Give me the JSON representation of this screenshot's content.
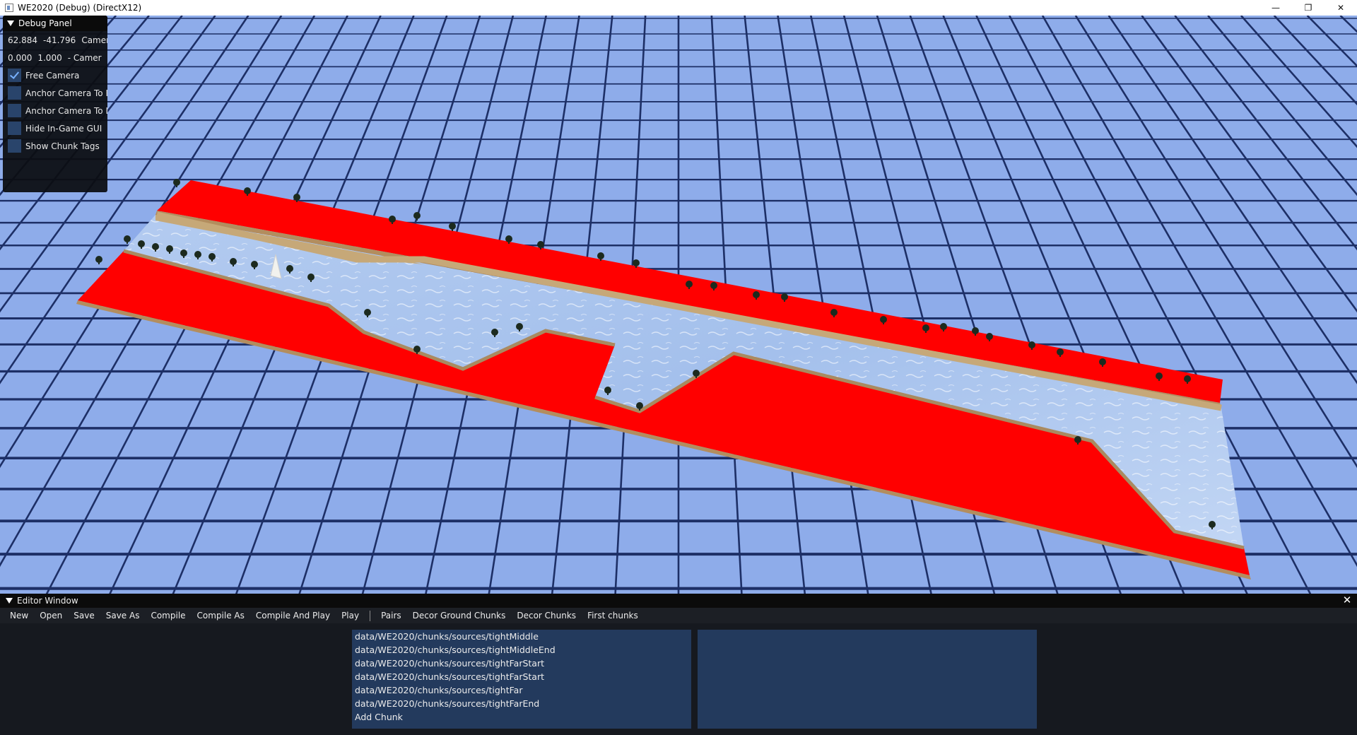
{
  "window": {
    "title": "WE2020 (Debug) (DirectX12)",
    "controls": [
      "—",
      "❐",
      "✕"
    ]
  },
  "debug_panel": {
    "title": "Debug Panel",
    "readouts": [
      {
        "values": [
          "62.884",
          "-41.796"
        ],
        "label": "Camer"
      },
      {
        "values": [
          "0.000",
          "1.000"
        ],
        "label": "- Camer"
      }
    ],
    "checkboxes": [
      {
        "label": "Free Camera",
        "checked": true
      },
      {
        "label": "Anchor Camera To I",
        "checked": false
      },
      {
        "label": "Anchor Camera To I",
        "checked": false
      },
      {
        "label": "Hide In-Game GUI",
        "checked": false
      },
      {
        "label": "Show Chunk Tags",
        "checked": false
      }
    ]
  },
  "editor": {
    "title": "Editor Window",
    "close": "✕",
    "menu": [
      "New",
      "Open",
      "Save",
      "Save As",
      "Compile",
      "Compile As",
      "Compile And Play",
      "Play"
    ],
    "menu2": [
      "Pairs",
      "Decor Ground Chunks",
      "Decor Chunks",
      "First chunks"
    ],
    "chunk_list": [
      "data/WE2020/chunks/sources/tightMiddle",
      "data/WE2020/chunks/sources/tightMiddleEnd",
      "data/WE2020/chunks/sources/tightFarStart",
      "data/WE2020/chunks/sources/tightFarStart",
      "data/WE2020/chunks/sources/tightFar",
      "data/WE2020/chunks/sources/tightFarEnd",
      "Add Chunk"
    ]
  },
  "colors": {
    "sky": "#97b4ea",
    "tile": "#7f9fdc",
    "grid_line": "#1d2f66",
    "ground": "#ff0000",
    "water": "#a6c2ee",
    "sand": "#c6a878",
    "panel_bg": "#0c0e12",
    "list_bg": "#233a5d"
  },
  "icons": {
    "collapse": "triangle-down-icon",
    "check": "checkmark-icon",
    "close": "close-icon"
  }
}
